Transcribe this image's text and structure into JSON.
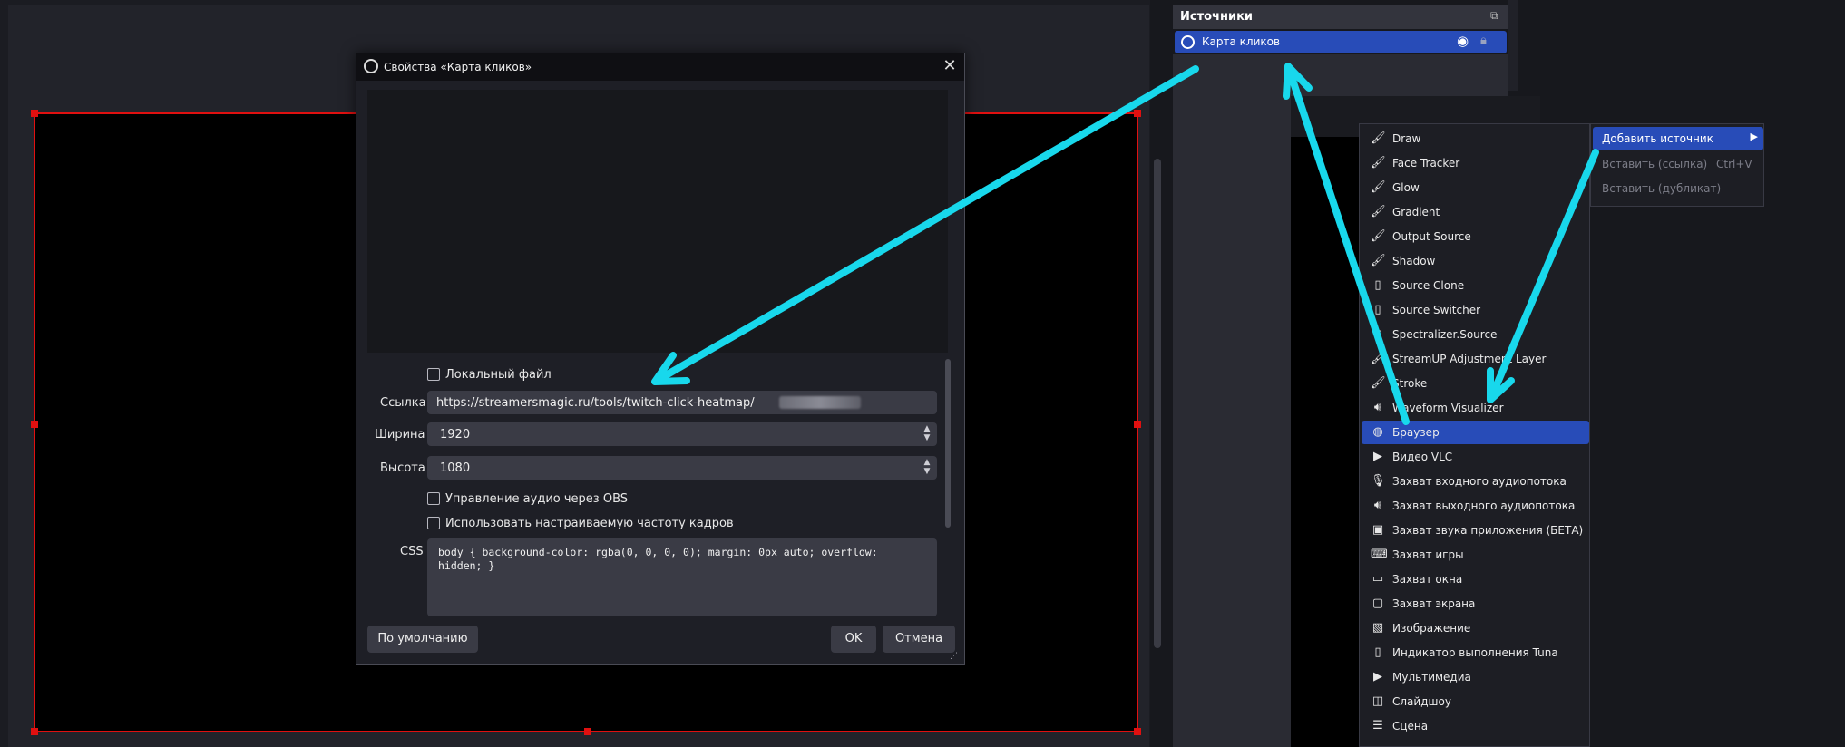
{
  "dialog": {
    "title": "Свойства «Карта кликов»",
    "close_label": "✕",
    "local_file_label": "Локальный файл",
    "url_label": "Ссылка",
    "url_value": "https://streamersmagic.ru/tools/twitch-click-heatmap/",
    "width_label": "Ширина",
    "width_value": "1920",
    "height_label": "Высота",
    "height_value": "1080",
    "audio_control_label": "Управление аудио через OBS",
    "custom_fps_label": "Использовать настраиваемую частоту кадров",
    "css_label": "CSS",
    "css_value": "body { background-color: rgba(0, 0, 0, 0); margin: 0px auto; overflow: hidden; }",
    "defaults_button": "По умолчанию",
    "ok_button": "OK",
    "cancel_button": "Отмена"
  },
  "sources": {
    "title": "Источники",
    "items": [
      {
        "label": "Карта кликов",
        "icon": "globe-icon",
        "visible": true,
        "locked": true
      }
    ]
  },
  "context_menu": {
    "items": [
      {
        "label": "Draw",
        "icon": "brush-icon"
      },
      {
        "label": "Face Tracker",
        "icon": "brush-icon"
      },
      {
        "label": "Glow",
        "icon": "brush-icon"
      },
      {
        "label": "Gradient",
        "icon": "brush-icon"
      },
      {
        "label": "Output Source",
        "icon": "brush-icon"
      },
      {
        "label": "Shadow",
        "icon": "brush-icon"
      },
      {
        "label": "Source Clone",
        "icon": "document-icon"
      },
      {
        "label": "Source Switcher",
        "icon": "document-icon"
      },
      {
        "label": "Spectralizer.Source",
        "icon": "speaker-icon"
      },
      {
        "label": "StreamUP Adjustment Layer",
        "icon": "brush-icon"
      },
      {
        "label": "Stroke",
        "icon": "brush-icon"
      },
      {
        "label": "Waveform Visualizer",
        "icon": "speaker-icon"
      },
      {
        "label": "Браузер",
        "icon": "globe-icon",
        "selected": true
      },
      {
        "label": "Видео VLC",
        "icon": "play-icon"
      },
      {
        "label": "Захват входного аудиопотока",
        "icon": "microphone-icon"
      },
      {
        "label": "Захват выходного аудиопотока",
        "icon": "speaker-icon"
      },
      {
        "label": "Захват звука приложения (БЕТА)",
        "icon": "app-audio-icon"
      },
      {
        "label": "Захват игры",
        "icon": "gamepad-icon"
      },
      {
        "label": "Захват окна",
        "icon": "window-icon"
      },
      {
        "label": "Захват экрана",
        "icon": "monitor-icon"
      },
      {
        "label": "Изображение",
        "icon": "image-icon"
      },
      {
        "label": "Индикатор выполнения Tuna",
        "icon": "document-icon"
      },
      {
        "label": "Мультимедиа",
        "icon": "play-icon"
      },
      {
        "label": "Слайдшоу",
        "icon": "slideshow-icon"
      },
      {
        "label": "Сцена",
        "icon": "list-icon"
      }
    ]
  },
  "submenu": {
    "add_source": "Добавить источник",
    "paste_ref": "Вставить (ссылка)",
    "paste_ref_shortcut": "Ctrl+V",
    "paste_dup": "Вставить (дубликат)"
  },
  "colors": {
    "accent": "#284cb8",
    "annotation_arrow": "#18d8ec",
    "selection_outline": "#e01010"
  }
}
